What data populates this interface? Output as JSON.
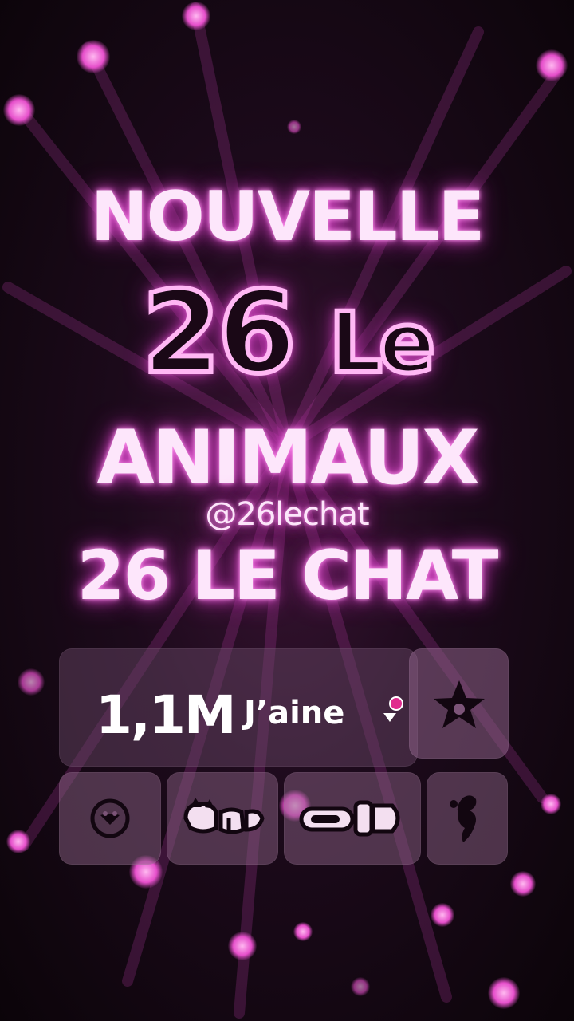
{
  "title": {
    "line1": "NOUVELLE",
    "line2_number": "26",
    "line2_word": "Le",
    "line3": "ANIMAUX",
    "handle": "@26lechat",
    "line5": "26 LE CHAT"
  },
  "likes": {
    "count": "1,1M",
    "label": "J’aine"
  },
  "icons": {
    "favorite": "star-paw-icon",
    "buttons": [
      "circle-paw-icon",
      "cat-group-icon",
      "toggle-pill-icon",
      "cat-silhouette-icon"
    ]
  },
  "colors": {
    "neon_pink": "#e34fd0",
    "neon_text": "#fde6fb",
    "background": "#1c0a1b",
    "dot": "#e02b8e"
  }
}
